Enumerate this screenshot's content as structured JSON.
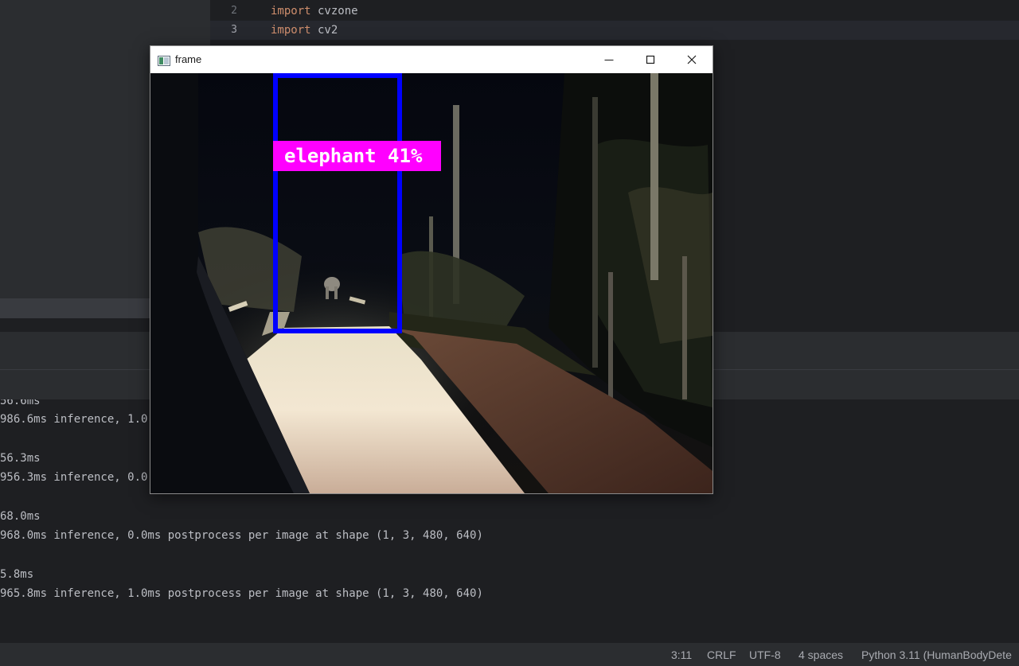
{
  "editor": {
    "lines": [
      {
        "num": "2",
        "keyword": "import",
        "rest": " cvzone"
      },
      {
        "num": "3",
        "keyword": "import",
        "rest": " cv2"
      }
    ]
  },
  "console": {
    "lines": [
      "56.6ms",
      "986.6ms inference, 1.0",
      "",
      "56.3ms",
      "956.3ms inference, 0.0",
      "",
      "68.0ms",
      "968.0ms inference, 0.0ms postprocess per image at shape (1, 3, 480, 640)",
      "",
      "5.8ms",
      "965.8ms inference, 1.0ms postprocess per image at shape (1, 3, 480, 640)"
    ]
  },
  "status_bar": {
    "position": "3:11",
    "line_ending": "CRLF",
    "encoding": "UTF-8",
    "indent": "4 spaces",
    "interpreter": "Python 3.11 (HumanBodyDete"
  },
  "cv_window": {
    "title": "frame",
    "icons": {
      "app": "opencv-window-icon",
      "minimize": "minimize-icon",
      "maximize": "maximize-icon",
      "close": "close-icon"
    },
    "detection": {
      "label": "elephant 41%",
      "box_color": "#0000ff",
      "label_color": "#ff00ff"
    }
  }
}
